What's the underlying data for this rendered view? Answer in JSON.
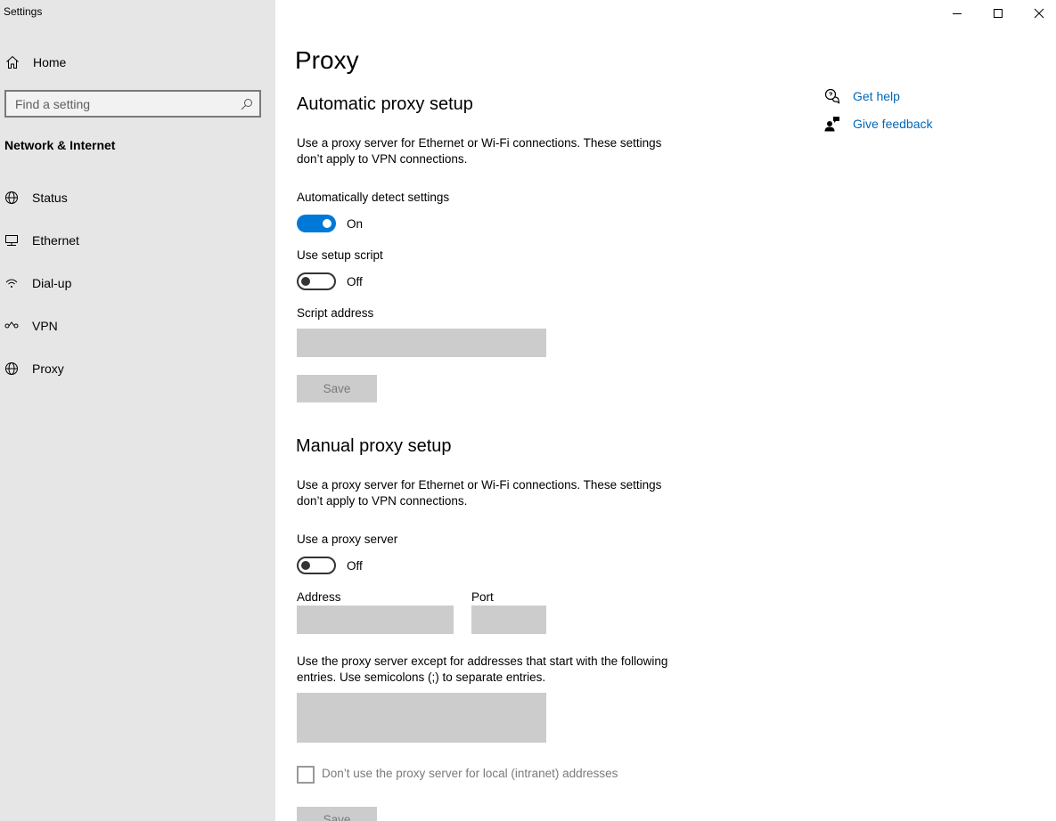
{
  "window": {
    "title": "Settings"
  },
  "sidebar": {
    "home_label": "Home",
    "search_placeholder": "Find a setting",
    "section_title": "Network & Internet",
    "items": [
      {
        "label": "Status",
        "icon": "status-globe-icon"
      },
      {
        "label": "Ethernet",
        "icon": "ethernet-icon"
      },
      {
        "label": "Dial-up",
        "icon": "dialup-icon"
      },
      {
        "label": "VPN",
        "icon": "vpn-icon"
      },
      {
        "label": "Proxy",
        "icon": "globe-icon"
      }
    ]
  },
  "main": {
    "title": "Proxy",
    "automatic": {
      "heading": "Automatic proxy setup",
      "description": "Use a proxy server for Ethernet or Wi-Fi connections. These settings don’t apply to VPN connections.",
      "auto_detect_label": "Automatically detect settings",
      "auto_detect_state": "On",
      "setup_script_label": "Use setup script",
      "setup_script_state": "Off",
      "script_address_label": "Script address",
      "script_address_value": "",
      "save_label": "Save"
    },
    "manual": {
      "heading": "Manual proxy setup",
      "description": "Use a proxy server for Ethernet or Wi-Fi connections. These settings don’t apply to VPN connections.",
      "use_proxy_label": "Use a proxy server",
      "use_proxy_state": "Off",
      "address_label": "Address",
      "address_value": "",
      "port_label": "Port",
      "port_value": "",
      "exceptions_description": "Use the proxy server except for addresses that start with the following entries. Use semicolons (;) to separate entries.",
      "exceptions_value": "",
      "local_checkbox_label": "Don’t use the proxy server for local (intranet) addresses",
      "save_label": "Save"
    }
  },
  "help": {
    "get_help": "Get help",
    "give_feedback": "Give feedback"
  },
  "colors": {
    "accent": "#0078d7",
    "link": "#0067b8",
    "sidebar_bg": "#e6e6e6",
    "disabled_field": "#cccccc"
  }
}
